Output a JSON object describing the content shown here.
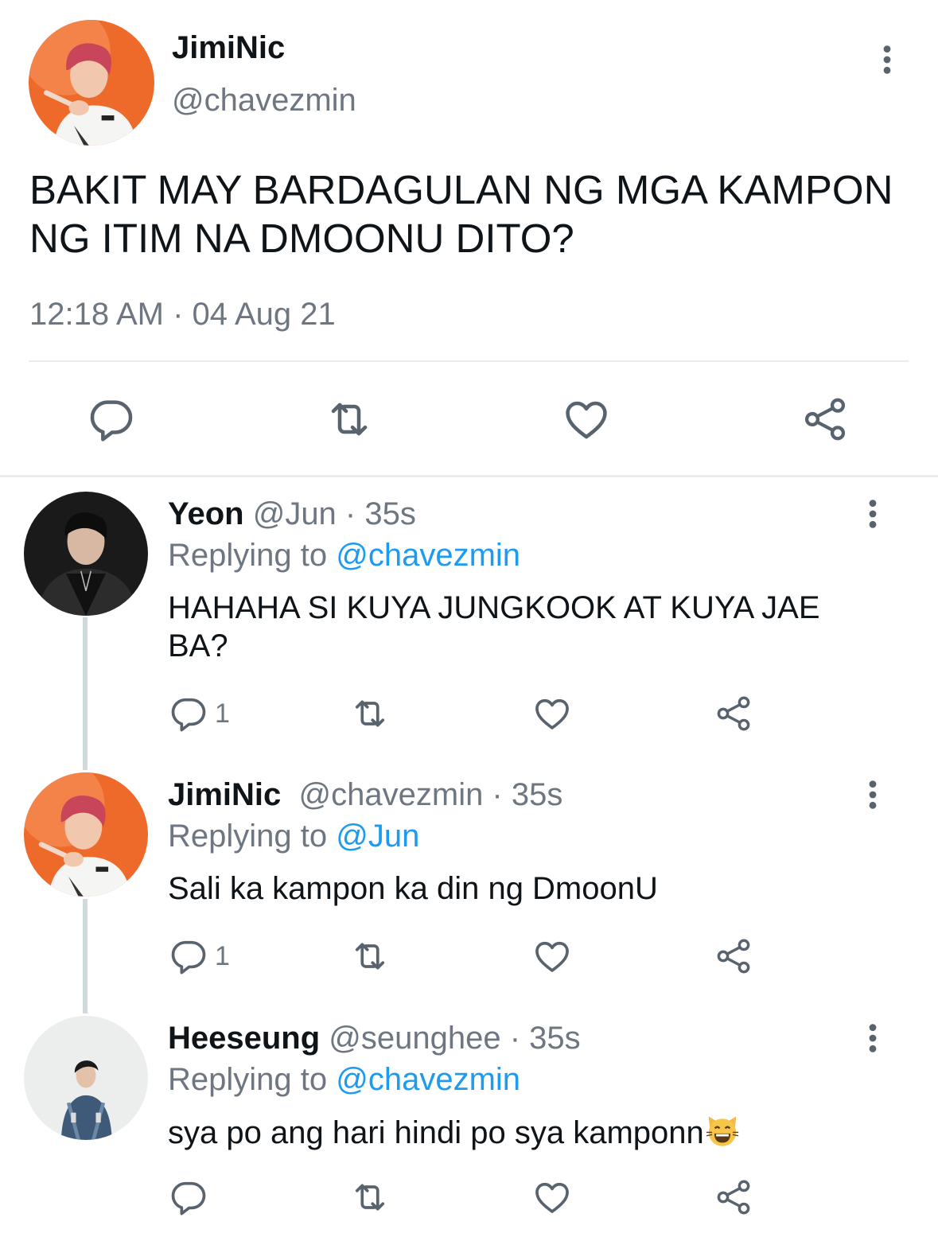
{
  "main_tweet": {
    "name": "JimiNic",
    "handle": "@chavezmin",
    "text": "BAKIT MAY BARDAGULAN NG MGA KAMPON NG ITIM NA DMOONU DITO?",
    "timestamp": "12:18 AM · 04 Aug 21",
    "actions": [
      "reply-icon",
      "retweet-icon",
      "like-icon",
      "share-icon"
    ]
  },
  "replies": [
    {
      "name": "Yeon",
      "meta": " @Jun · 35s",
      "replying_prefix": "Replying to ",
      "replying_to": "@chavezmin",
      "text": "HAHAHA SI KUYA JUNGKOOK AT KUYA JAE BA?",
      "reply_count": "1"
    },
    {
      "name": "JimiNic",
      "meta": "  @chavezmin · 35s",
      "replying_prefix": "Replying to ",
      "replying_to": "@Jun",
      "text": "Sali ka kampon ka din ng DmoonU",
      "reply_count": "1"
    },
    {
      "name": "Heeseung",
      "meta": " @seunghee · 35s",
      "replying_prefix": "Replying to ",
      "replying_to": "@chavezmin",
      "text": "sya po ang hari hindi po sya kamponn",
      "emoji": "grinning-cat-icon",
      "reply_count": ""
    }
  ],
  "colors": {
    "text": "#0f1419",
    "secondary": "#6e7781",
    "link": "#1d9bf0",
    "divider": "#e6ecf0",
    "thread_line": "#cfd9de"
  }
}
